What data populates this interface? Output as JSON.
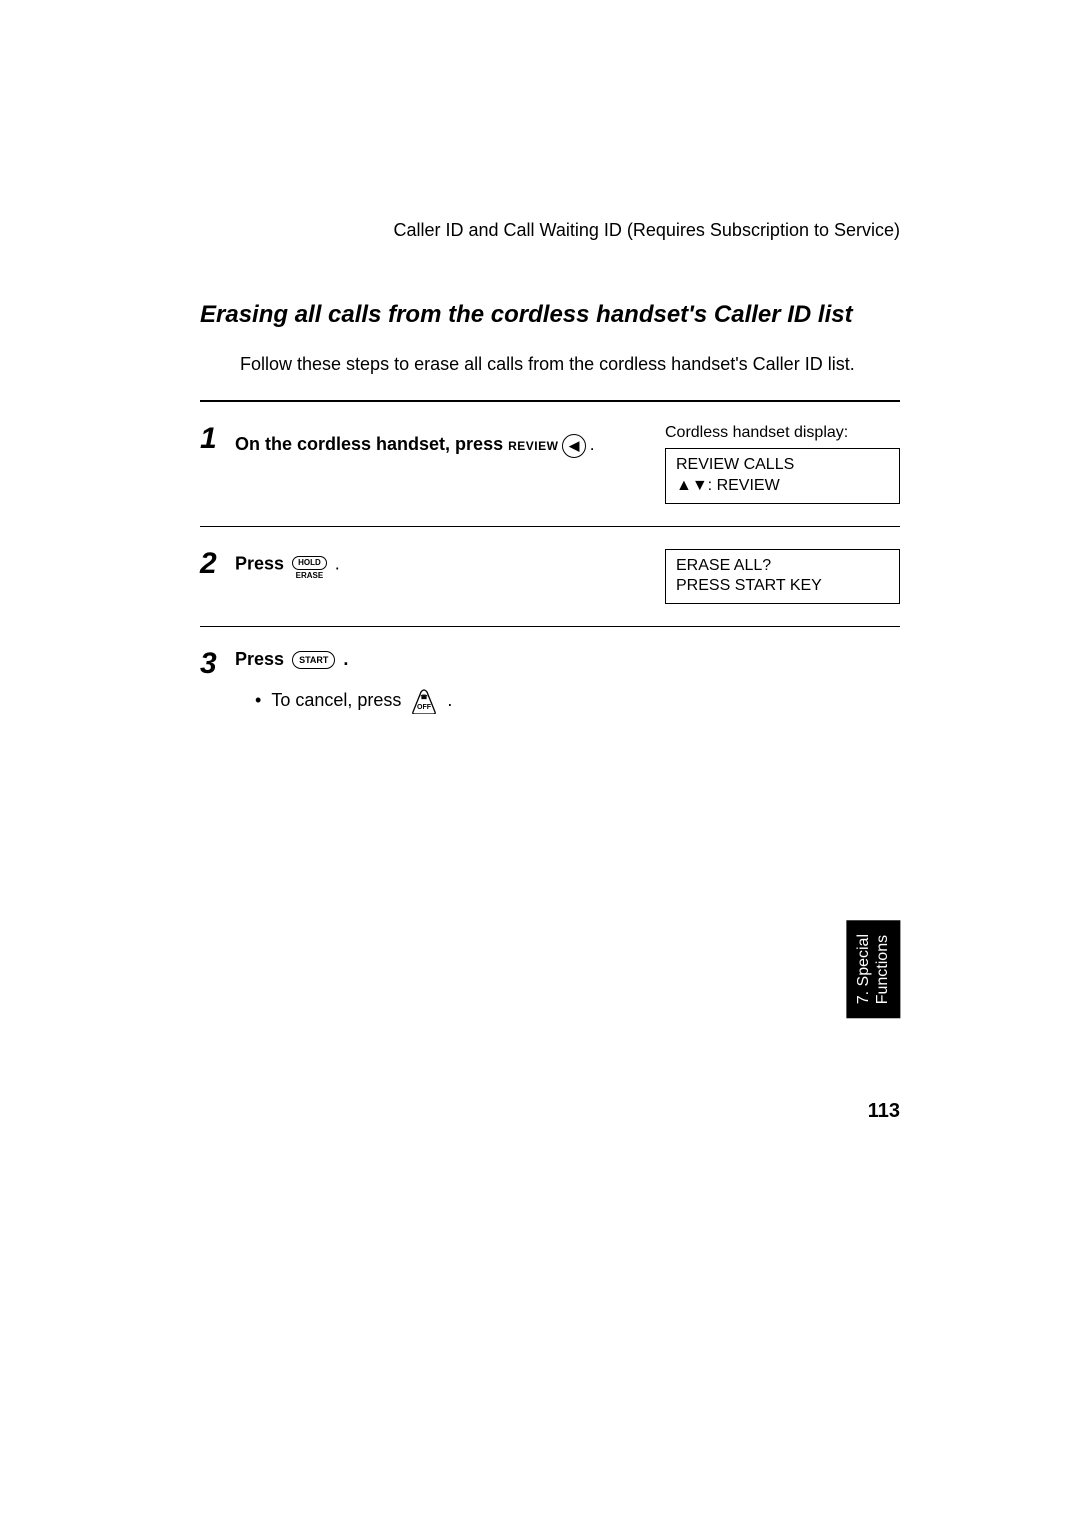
{
  "header": "Caller ID and Call Waiting ID (Requires Subscription to Service)",
  "title": "Erasing all calls from the cordless handset's Caller ID list",
  "intro": "Follow these steps to erase all calls from the cordless handset's Caller ID list.",
  "steps": {
    "s1": {
      "num": "1",
      "text": "On the cordless handset, press",
      "review_label": "REVIEW",
      "display_label": "Cordless handset display:",
      "display_line1": "REVIEW CALLS",
      "display_line2": "▲▼: REVIEW"
    },
    "s2": {
      "num": "2",
      "press": "Press",
      "hold_top": "HOLD",
      "hold_bottom": "ERASE",
      "display_line1": "ERASE ALL?",
      "display_line2": "PRESS START KEY"
    },
    "s3": {
      "num": "3",
      "press": "Press",
      "start": "START",
      "cancel_text": "To cancel, press",
      "off": "OFF"
    }
  },
  "side_tab": "7. Special\nFunctions",
  "pagenum": "113"
}
